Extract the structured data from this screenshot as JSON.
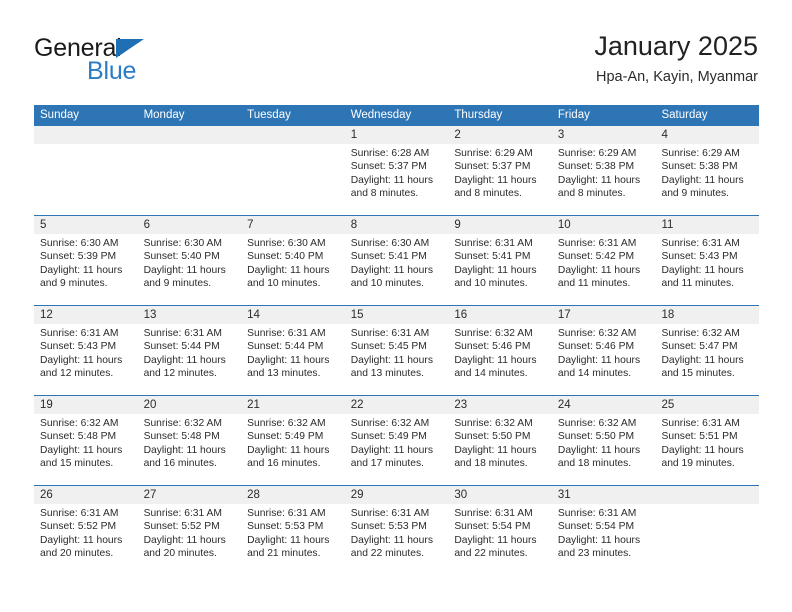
{
  "brand": {
    "name_part1": "General",
    "name_part2": "Blue",
    "triangle_color": "#1f6fb5",
    "blue_color": "#2b7cc4"
  },
  "header": {
    "title": "January 2025",
    "subtitle": "Hpa-An, Kayin, Myanmar"
  },
  "theme": {
    "header_blue": "#2e75b6",
    "number_band": "#f0f0f0",
    "text": "#2b2b2b"
  },
  "weekdays": [
    "Sunday",
    "Monday",
    "Tuesday",
    "Wednesday",
    "Thursday",
    "Friday",
    "Saturday"
  ],
  "weeks": [
    {
      "days": [
        {
          "num": "",
          "lines": []
        },
        {
          "num": "",
          "lines": []
        },
        {
          "num": "",
          "lines": []
        },
        {
          "num": "1",
          "lines": [
            "Sunrise: 6:28 AM",
            "Sunset: 5:37 PM",
            "Daylight: 11 hours",
            "and 8 minutes."
          ]
        },
        {
          "num": "2",
          "lines": [
            "Sunrise: 6:29 AM",
            "Sunset: 5:37 PM",
            "Daylight: 11 hours",
            "and 8 minutes."
          ]
        },
        {
          "num": "3",
          "lines": [
            "Sunrise: 6:29 AM",
            "Sunset: 5:38 PM",
            "Daylight: 11 hours",
            "and 8 minutes."
          ]
        },
        {
          "num": "4",
          "lines": [
            "Sunrise: 6:29 AM",
            "Sunset: 5:38 PM",
            "Daylight: 11 hours",
            "and 9 minutes."
          ]
        }
      ]
    },
    {
      "days": [
        {
          "num": "5",
          "lines": [
            "Sunrise: 6:30 AM",
            "Sunset: 5:39 PM",
            "Daylight: 11 hours",
            "and 9 minutes."
          ]
        },
        {
          "num": "6",
          "lines": [
            "Sunrise: 6:30 AM",
            "Sunset: 5:40 PM",
            "Daylight: 11 hours",
            "and 9 minutes."
          ]
        },
        {
          "num": "7",
          "lines": [
            "Sunrise: 6:30 AM",
            "Sunset: 5:40 PM",
            "Daylight: 11 hours",
            "and 10 minutes."
          ]
        },
        {
          "num": "8",
          "lines": [
            "Sunrise: 6:30 AM",
            "Sunset: 5:41 PM",
            "Daylight: 11 hours",
            "and 10 minutes."
          ]
        },
        {
          "num": "9",
          "lines": [
            "Sunrise: 6:31 AM",
            "Sunset: 5:41 PM",
            "Daylight: 11 hours",
            "and 10 minutes."
          ]
        },
        {
          "num": "10",
          "lines": [
            "Sunrise: 6:31 AM",
            "Sunset: 5:42 PM",
            "Daylight: 11 hours",
            "and 11 minutes."
          ]
        },
        {
          "num": "11",
          "lines": [
            "Sunrise: 6:31 AM",
            "Sunset: 5:43 PM",
            "Daylight: 11 hours",
            "and 11 minutes."
          ]
        }
      ]
    },
    {
      "days": [
        {
          "num": "12",
          "lines": [
            "Sunrise: 6:31 AM",
            "Sunset: 5:43 PM",
            "Daylight: 11 hours",
            "and 12 minutes."
          ]
        },
        {
          "num": "13",
          "lines": [
            "Sunrise: 6:31 AM",
            "Sunset: 5:44 PM",
            "Daylight: 11 hours",
            "and 12 minutes."
          ]
        },
        {
          "num": "14",
          "lines": [
            "Sunrise: 6:31 AM",
            "Sunset: 5:44 PM",
            "Daylight: 11 hours",
            "and 13 minutes."
          ]
        },
        {
          "num": "15",
          "lines": [
            "Sunrise: 6:31 AM",
            "Sunset: 5:45 PM",
            "Daylight: 11 hours",
            "and 13 minutes."
          ]
        },
        {
          "num": "16",
          "lines": [
            "Sunrise: 6:32 AM",
            "Sunset: 5:46 PM",
            "Daylight: 11 hours",
            "and 14 minutes."
          ]
        },
        {
          "num": "17",
          "lines": [
            "Sunrise: 6:32 AM",
            "Sunset: 5:46 PM",
            "Daylight: 11 hours",
            "and 14 minutes."
          ]
        },
        {
          "num": "18",
          "lines": [
            "Sunrise: 6:32 AM",
            "Sunset: 5:47 PM",
            "Daylight: 11 hours",
            "and 15 minutes."
          ]
        }
      ]
    },
    {
      "days": [
        {
          "num": "19",
          "lines": [
            "Sunrise: 6:32 AM",
            "Sunset: 5:48 PM",
            "Daylight: 11 hours",
            "and 15 minutes."
          ]
        },
        {
          "num": "20",
          "lines": [
            "Sunrise: 6:32 AM",
            "Sunset: 5:48 PM",
            "Daylight: 11 hours",
            "and 16 minutes."
          ]
        },
        {
          "num": "21",
          "lines": [
            "Sunrise: 6:32 AM",
            "Sunset: 5:49 PM",
            "Daylight: 11 hours",
            "and 16 minutes."
          ]
        },
        {
          "num": "22",
          "lines": [
            "Sunrise: 6:32 AM",
            "Sunset: 5:49 PM",
            "Daylight: 11 hours",
            "and 17 minutes."
          ]
        },
        {
          "num": "23",
          "lines": [
            "Sunrise: 6:32 AM",
            "Sunset: 5:50 PM",
            "Daylight: 11 hours",
            "and 18 minutes."
          ]
        },
        {
          "num": "24",
          "lines": [
            "Sunrise: 6:32 AM",
            "Sunset: 5:50 PM",
            "Daylight: 11 hours",
            "and 18 minutes."
          ]
        },
        {
          "num": "25",
          "lines": [
            "Sunrise: 6:31 AM",
            "Sunset: 5:51 PM",
            "Daylight: 11 hours",
            "and 19 minutes."
          ]
        }
      ]
    },
    {
      "days": [
        {
          "num": "26",
          "lines": [
            "Sunrise: 6:31 AM",
            "Sunset: 5:52 PM",
            "Daylight: 11 hours",
            "and 20 minutes."
          ]
        },
        {
          "num": "27",
          "lines": [
            "Sunrise: 6:31 AM",
            "Sunset: 5:52 PM",
            "Daylight: 11 hours",
            "and 20 minutes."
          ]
        },
        {
          "num": "28",
          "lines": [
            "Sunrise: 6:31 AM",
            "Sunset: 5:53 PM",
            "Daylight: 11 hours",
            "and 21 minutes."
          ]
        },
        {
          "num": "29",
          "lines": [
            "Sunrise: 6:31 AM",
            "Sunset: 5:53 PM",
            "Daylight: 11 hours",
            "and 22 minutes."
          ]
        },
        {
          "num": "30",
          "lines": [
            "Sunrise: 6:31 AM",
            "Sunset: 5:54 PM",
            "Daylight: 11 hours",
            "and 22 minutes."
          ]
        },
        {
          "num": "31",
          "lines": [
            "Sunrise: 6:31 AM",
            "Sunset: 5:54 PM",
            "Daylight: 11 hours",
            "and 23 minutes."
          ]
        },
        {
          "num": "",
          "lines": []
        }
      ]
    }
  ]
}
